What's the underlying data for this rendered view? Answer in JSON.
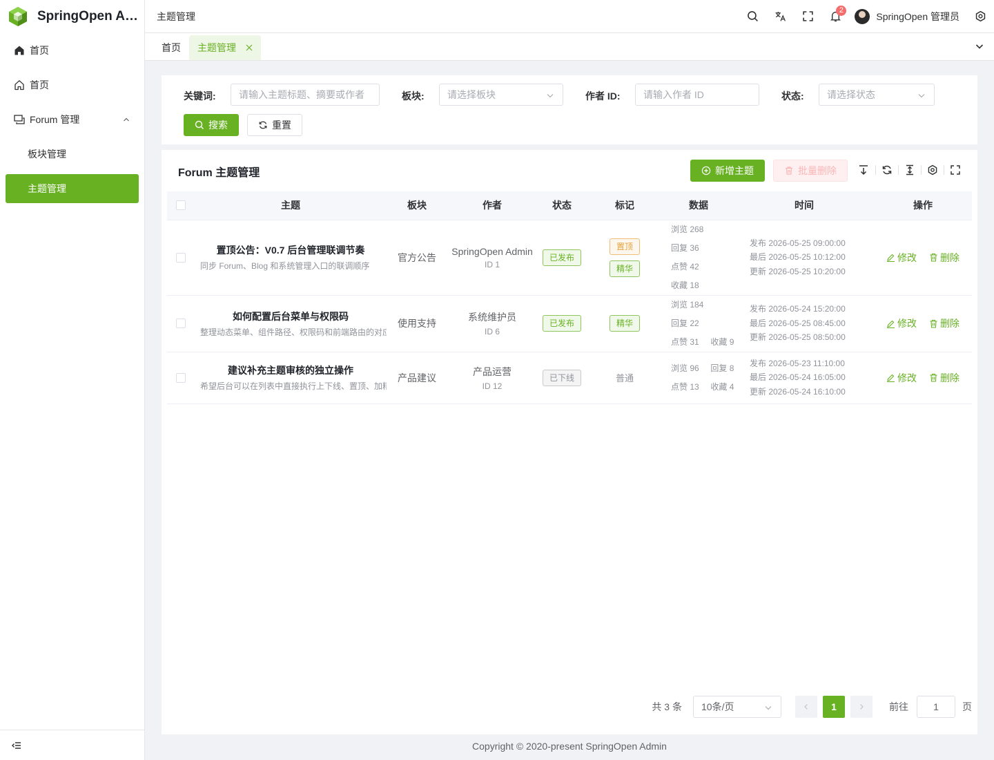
{
  "app": {
    "title": "SpringOpen Admin",
    "logo_text": "SpringOpen Ad..."
  },
  "sidebar": {
    "items": [
      {
        "label": "首页",
        "icon": "home-filled-icon"
      },
      {
        "label": "首页",
        "icon": "home-outline-icon"
      },
      {
        "label": "Forum 管理",
        "icon": "forum-icon",
        "expanded": true
      },
      {
        "label": "板块管理"
      },
      {
        "label": "主题管理",
        "active": true
      }
    ]
  },
  "header": {
    "breadcrumb": "主题管理",
    "notification_count": "2",
    "username": "SpringOpen 管理员"
  },
  "tabs": [
    {
      "label": "首页"
    },
    {
      "label": "主题管理",
      "active": true
    }
  ],
  "filters": {
    "keyword": {
      "label": "关键词:",
      "placeholder": "请输入主题标题、摘要或作者",
      "value": ""
    },
    "board": {
      "label": "板块:",
      "placeholder": "请选择板块"
    },
    "author_id": {
      "label": "作者 ID:",
      "placeholder": "请输入作者 ID",
      "value": ""
    },
    "status": {
      "label": "状态:",
      "placeholder": "请选择状态"
    },
    "search_label": "搜索",
    "reset_label": "重置"
  },
  "table_card": {
    "title": "Forum 主题管理",
    "add_label": "新增主题",
    "batch_delete_label": "批量删除"
  },
  "table": {
    "columns": [
      "主题",
      "板块",
      "作者",
      "状态",
      "标记",
      "数据",
      "时间",
      "操作"
    ],
    "rows": [
      {
        "title": "置顶公告：V0.7 后台管理联调节奏",
        "summary": "同步 Forum、Blog 和系统管理入口的联调顺序",
        "board": "官方公告",
        "author": "SpringOpen Admin",
        "author_id": "ID 1",
        "status": "已发布",
        "marks": [
          "置顶",
          "精华"
        ],
        "stats": {
          "views": "浏览 268",
          "replies": "回复 36",
          "likes": "点赞 42",
          "favs": "收藏 18"
        },
        "times": {
          "publish": "发布 2026-05-25 09:00:00",
          "last": "最后 2026-05-25 10:12:00",
          "update": "更新 2026-05-25 10:20:00"
        }
      },
      {
        "title": "如何配置后台菜单与权限码",
        "summary": "整理动态菜单、组件路径、权限码和前端路由的对应关系",
        "board": "使用支持",
        "author": "系统维护员",
        "author_id": "ID 6",
        "status": "已发布",
        "marks": [
          "精华"
        ],
        "stats": {
          "views": "浏览 184",
          "replies": "回复 22",
          "likes": "点赞 31",
          "favs": "收藏 9"
        },
        "times": {
          "publish": "发布 2026-05-24 15:20:00",
          "last": "最后 2026-05-25 08:45:00",
          "update": "更新 2026-05-25 08:50:00"
        }
      },
      {
        "title": "建议补充主题审核的独立操作",
        "summary": "希望后台可以在列表中直接执行上下线、置顶、加精",
        "board": "产品建议",
        "author": "产品运营",
        "author_id": "ID 12",
        "status": "已下线",
        "marks_text": "普通",
        "stats": {
          "views": "浏览 96",
          "replies": "回复 8",
          "likes": "点赞 13",
          "favs": "收藏 4"
        },
        "times": {
          "publish": "发布 2026-05-23 11:10:00",
          "last": "最后 2026-05-24 16:05:00",
          "update": "更新 2026-05-24 16:10:00"
        }
      }
    ],
    "edit_label": "修改",
    "delete_label": "删除"
  },
  "pagination": {
    "total": "共 3 条",
    "page_size": "10条/页",
    "current_page": "1",
    "goto_label": "前往",
    "goto_value": "1",
    "page_suffix": "页"
  },
  "footer": {
    "copyright": "Copyright © 2020-present SpringOpen Admin"
  },
  "colors": {
    "primary": "#67b123",
    "danger": "#f56c6c",
    "warning": "#e6a23c"
  }
}
